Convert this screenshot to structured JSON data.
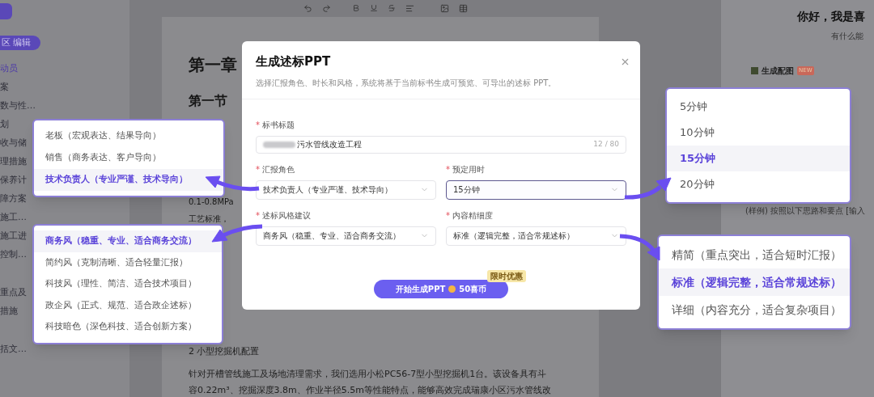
{
  "sidebar": {
    "edit_pill": "区 编辑",
    "items": [
      {
        "label": "动员",
        "selected": true
      },
      {
        "label": "案",
        "selected": false
      },
      {
        "label": "数与性…",
        "selected": false
      },
      {
        "label": "划",
        "selected": false
      },
      {
        "label": "收与储",
        "selected": false
      },
      {
        "label": "理措施",
        "selected": false
      },
      {
        "label": "保养计",
        "selected": false
      },
      {
        "label": "障方案",
        "selected": false
      },
      {
        "label": "施工…",
        "selected": false
      },
      {
        "label": "施工进",
        "selected": false
      },
      {
        "label": "控制…",
        "selected": false
      },
      {
        "label": "重点及",
        "selected": false
      },
      {
        "label": "措施",
        "selected": false
      },
      {
        "label": "括文…",
        "selected": false
      }
    ]
  },
  "document": {
    "chapter": "第一章",
    "section": "第一节",
    "lines": [
      "0.1-0.8MPa",
      "工艺标准，"
    ],
    "subheading": "2 小型挖掘机配置",
    "paragraph": [
      "针对开槽管线施工及场地清理需求，我们选用小松PC56-7型小型挖掘机1台。该设备具有斗",
      "容0.22m³、挖掘深度3.8m、作业半径5.5m等性能特点，能够高效完成瑞康小区污水管线改"
    ]
  },
  "assistant": {
    "greeting": "你好，我是喜",
    "subtitle": "有什么能",
    "card_title": "生成配图",
    "card_badge": "NEW",
    "sample": "(样例) 按照以下思路和要点 [输入"
  },
  "modal": {
    "title": "生成述标PPT",
    "description": "选择汇报角色、时长和风格，系统将基于当前标书生成可预览、可导出的述标 PPT。",
    "fields": [
      {
        "kind": "text",
        "label": "标书标题",
        "required_mark": "*",
        "value": "污水管线改造工程",
        "counter": "12 / 80"
      },
      {
        "kind": "select",
        "label": "汇报角色",
        "required_mark": "*",
        "value": "技术负责人（专业严谨、技术导向）",
        "focused": false,
        "options": [
          {
            "label": "老板（宏观表达、结果导向）",
            "selected": false
          },
          {
            "label": "销售（商务表达、客户导向）",
            "selected": false
          },
          {
            "label": "技术负责人（专业严谨、技术导向）",
            "selected": true
          }
        ]
      },
      {
        "kind": "select",
        "label": "预定用时",
        "required_mark": "*",
        "value": "15分钟",
        "focused": true,
        "options": [
          {
            "label": "5分钟",
            "selected": false
          },
          {
            "label": "10分钟",
            "selected": false
          },
          {
            "label": "15分钟",
            "selected": true
          },
          {
            "label": "20分钟",
            "selected": false
          }
        ]
      },
      {
        "kind": "select",
        "label": "述标风格建议",
        "required_mark": "*",
        "value": "商务风（稳重、专业、适合商务交流）",
        "focused": false,
        "options": [
          {
            "label": "商务风（稳重、专业、适合商务交流）",
            "selected": true
          },
          {
            "label": "简约风（克制清晰、适合轻量汇报）",
            "selected": false
          },
          {
            "label": "科技风（理性、简洁、适合技术项目）",
            "selected": false
          },
          {
            "label": "政企风（正式、规范、适合政企述标）",
            "selected": false
          },
          {
            "label": "科技暗色（深色科技、适合创新方案）",
            "selected": false
          }
        ]
      },
      {
        "kind": "select",
        "label": "内容精细度",
        "required_mark": "*",
        "value": "标准（逻辑完整，适合常规述标）",
        "focused": false,
        "options": [
          {
            "label": "精简（重点突出，适合短时汇报）",
            "selected": false
          },
          {
            "label": "标准（逻辑完整，适合常规述标）",
            "selected": true
          },
          {
            "label": "详细（内容充分，适合复杂项目）",
            "selected": false
          }
        ]
      }
    ],
    "submit": {
      "label": "开始生成PPT",
      "price": "50喜币",
      "badge": "限时优惠"
    }
  }
}
